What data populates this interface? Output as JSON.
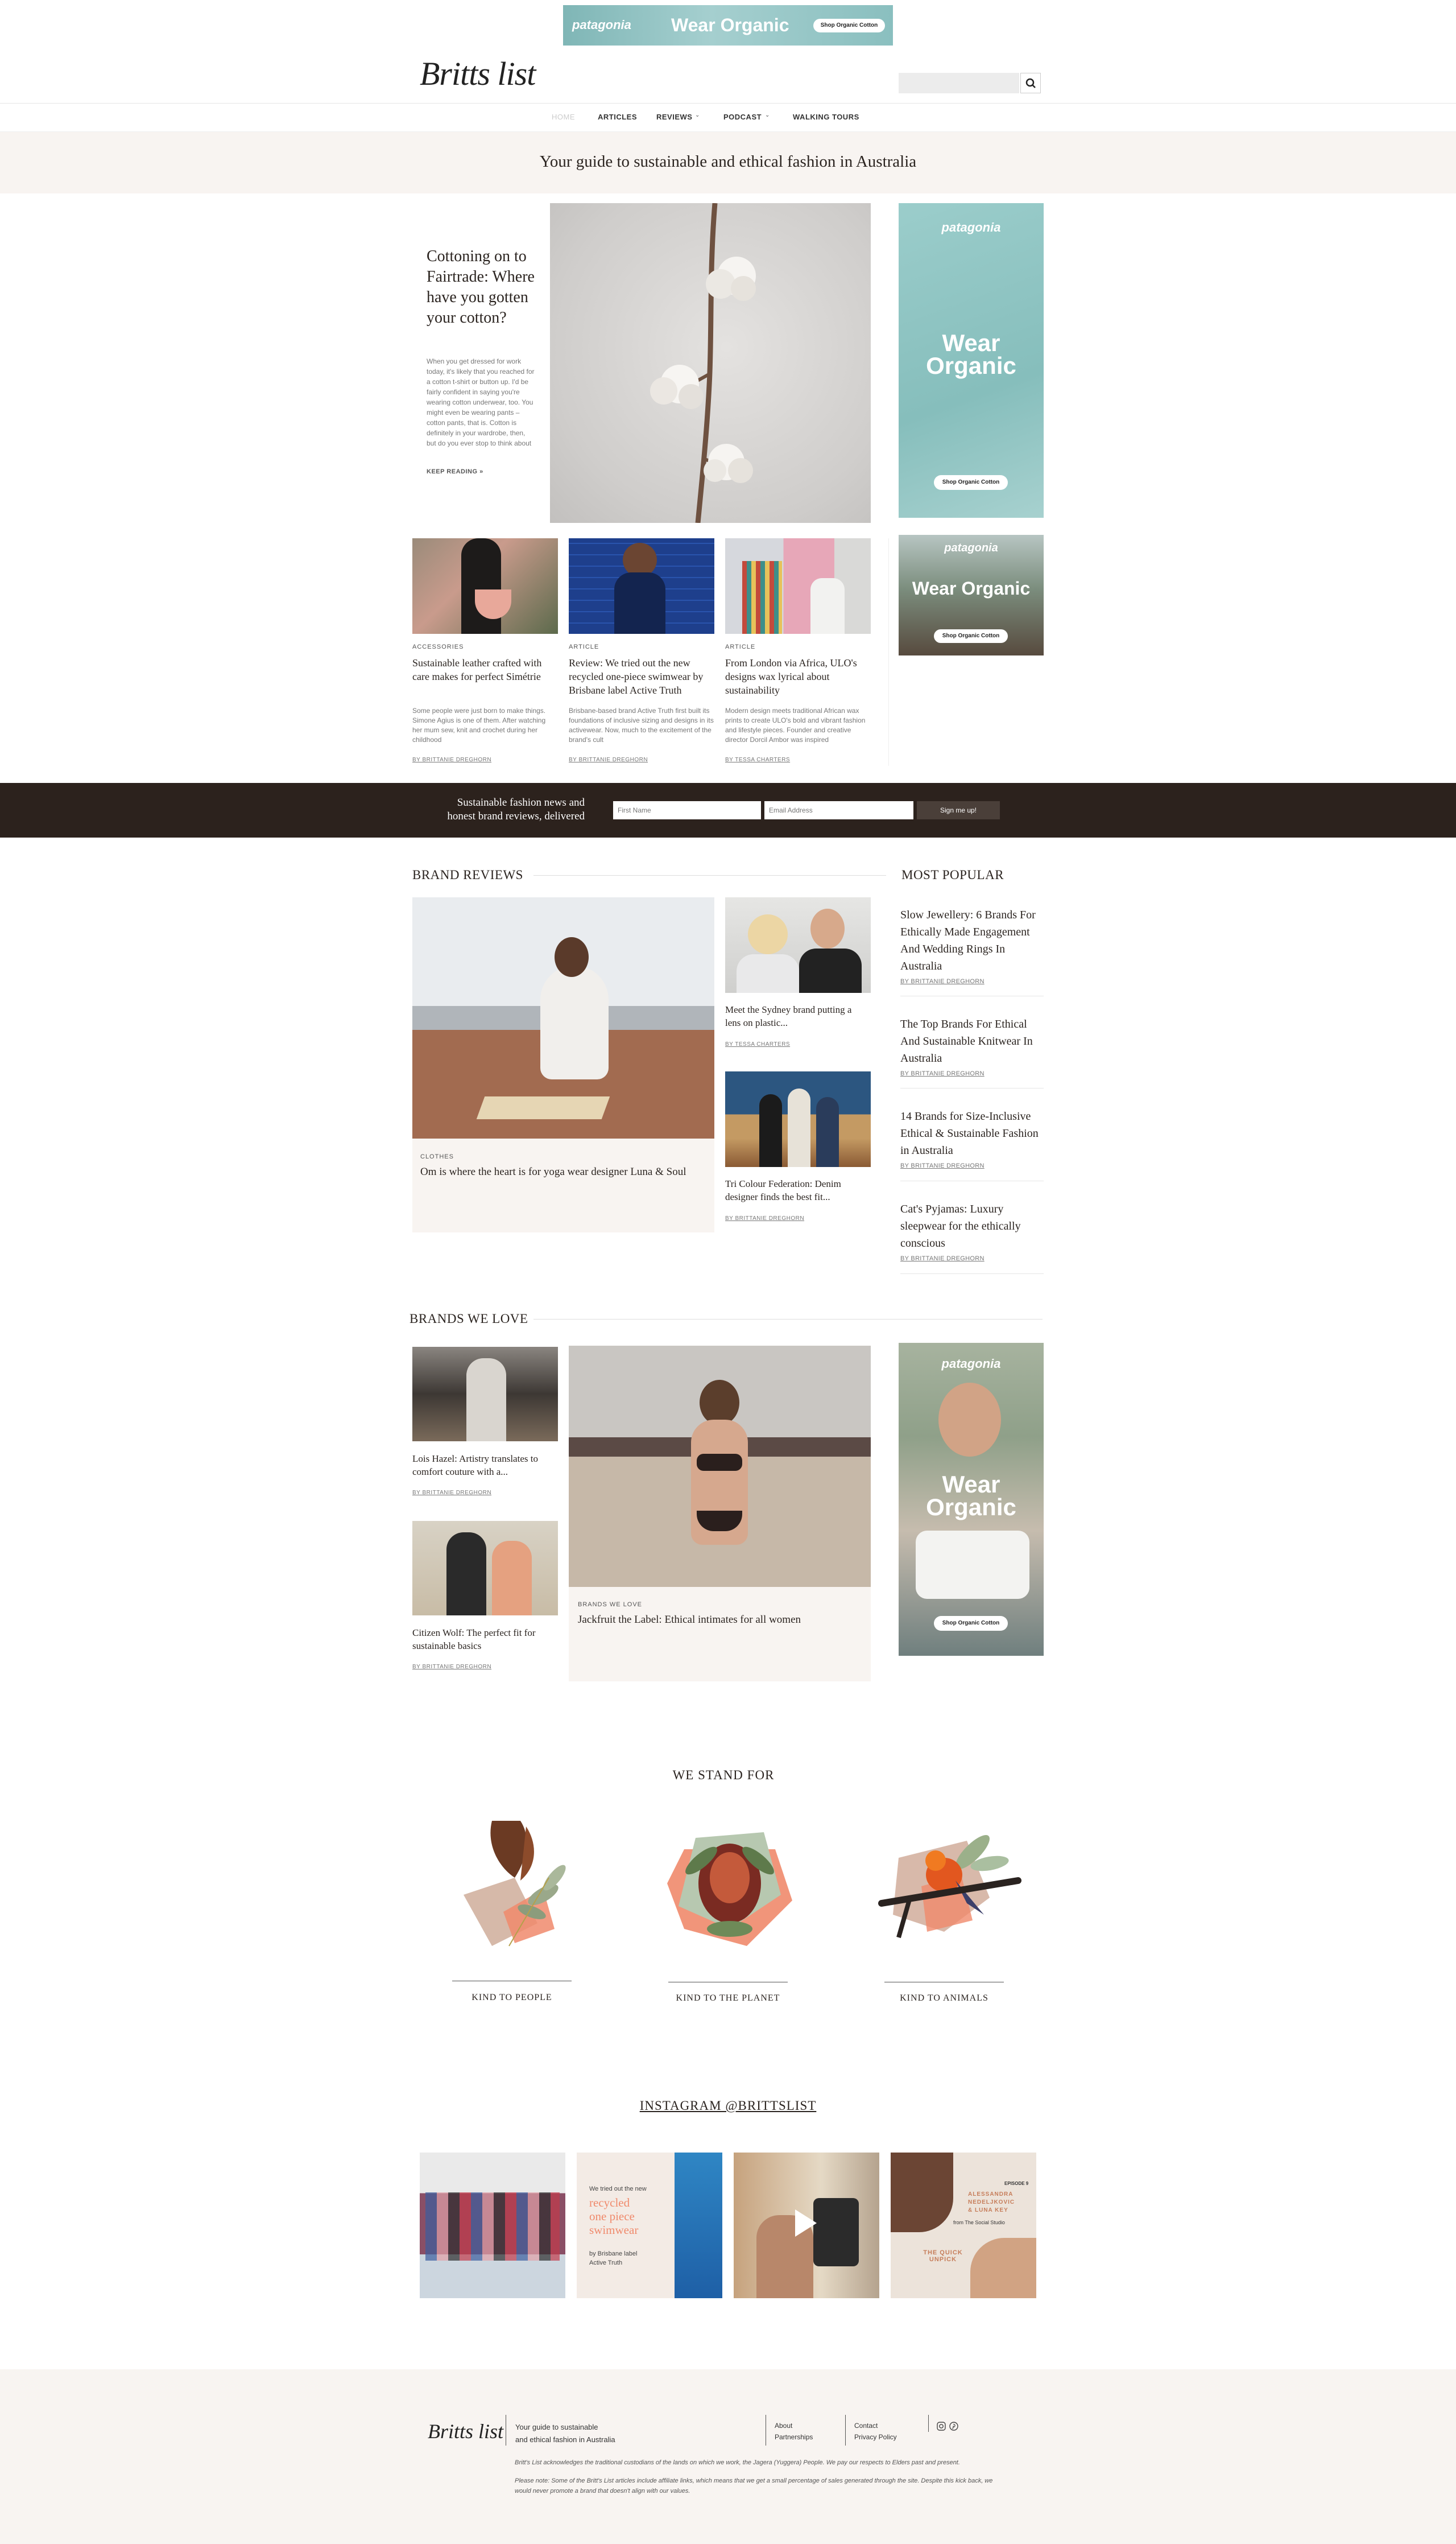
{
  "top_ad": {
    "brand": "patagonia",
    "headline": "Wear Organic",
    "cta": "Shop Organic Cotton"
  },
  "header": {
    "logo": "Britts list",
    "search_placeholder": ""
  },
  "nav": {
    "home": "HOME",
    "articles": "ARTICLES",
    "reviews": "REVIEWS",
    "podcast": "PODCAST",
    "walking_tours": "WALKING TOURS"
  },
  "tagline": "Your guide to sustainable and ethical fashion in Australia",
  "feature": {
    "title": "Cottoning on to Fairtrade: Where have you gotten your cotton?",
    "excerpt": "When you get dressed for work today, it's likely that you reached for a cotton t-shirt or button up. I'd be fairly confident in saying you're wearing cotton underwear, too. You might even be wearing pants – cotton pants, that is. Cotton is definitely in your wardrobe, then, but do you ever stop to think about",
    "read_more": "KEEP READING »"
  },
  "side_ad_1": {
    "brand": "patagonia",
    "line1": "Wear",
    "line2": "Organic",
    "cta": "Shop Organic Cotton"
  },
  "side_ad_2": {
    "brand": "patagonia",
    "headline": "Wear Organic",
    "cta": "Shop Organic Cotton"
  },
  "side_ad_3": {
    "brand": "patagonia",
    "line1": "Wear",
    "line2": "Organic",
    "cta": "Shop Organic Cotton"
  },
  "cards": [
    {
      "category": "ACCESSORIES",
      "title": "Sustainable leather crafted with care makes for perfect Simétrie",
      "excerpt": "Some people were just born to make things. Simone Agius is one of them. After watching her mum sew, knit and crochet during her childhood",
      "byline": "BY BRITTANIE DREGHORN"
    },
    {
      "category": "ARTICLE",
      "title": "Review: We tried out the new recycled one-piece swimwear by Brisbane label Active Truth",
      "excerpt": "Brisbane-based brand Active Truth first built its foundations of inclusive sizing and designs in its activewear. Now, much to the excitement of the brand's cult",
      "byline": "BY BRITTANIE DREGHORN"
    },
    {
      "category": "ARTICLE",
      "title": "From London via Africa, ULO's designs wax lyrical about sustainability",
      "excerpt": "Modern design meets traditional African wax prints to create ULO's bold and vibrant fashion and lifestyle pieces. Founder and creative director Dorcil Ambor was inspired",
      "byline": "BY TESSA CHARTERS"
    }
  ],
  "newsletter": {
    "text_line1": "Sustainable fashion news and",
    "text_line2": "honest brand reviews, delivered",
    "first_name_placeholder": "First Name",
    "email_placeholder": "Email Address",
    "button": "Sign me up!"
  },
  "brand_reviews": {
    "heading": "BRAND REVIEWS",
    "main": {
      "category": "CLOTHES",
      "title": "Om is where the heart is for yoga wear designer Luna & Soul"
    },
    "side": [
      {
        "title": "Meet the Sydney brand putting a lens on plastic...",
        "byline": "BY TESSA CHARTERS"
      },
      {
        "title": "Tri Colour Federation: Denim designer finds the best fit...",
        "byline": "BY BRITTANIE DREGHORN"
      }
    ]
  },
  "most_popular": {
    "heading": "MOST POPULAR",
    "items": [
      {
        "title": "Slow Jewellery: 6 Brands For Ethically Made Engagement And Wedding Rings In Australia",
        "byline": "BY BRITTANIE DREGHORN"
      },
      {
        "title": "The Top Brands For Ethical And Sustainable Knitwear In Australia",
        "byline": "BY BRITTANIE DREGHORN"
      },
      {
        "title": "14 Brands for Size-Inclusive Ethical & Sustainable Fashion in Australia",
        "byline": "BY BRITTANIE DREGHORN"
      },
      {
        "title": "Cat's Pyjamas: Luxury sleepwear for the ethically conscious",
        "byline": "BY BRITTANIE DREGHORN"
      }
    ]
  },
  "brands_we_love": {
    "heading": "BRANDS WE LOVE",
    "side": [
      {
        "title": "Lois Hazel: Artistry translates to comfort couture with a...",
        "byline": "BY BRITTANIE DREGHORN"
      },
      {
        "title": "Citizen Wolf: The perfect fit for sustainable basics",
        "byline": "BY BRITTANIE DREGHORN"
      }
    ],
    "main": {
      "category": "BRANDS WE LOVE",
      "title": "Jackfruit the Label: Ethical intimates for all women"
    }
  },
  "values": {
    "heading": "WE STAND FOR",
    "items": [
      "KIND TO PEOPLE",
      "KIND TO THE PLANET",
      "KIND TO ANIMALS"
    ]
  },
  "instagram": {
    "heading": "INSTAGRAM @BRITTSLIST",
    "post2": {
      "line1": "We tried out the new",
      "line2": "recycled",
      "line3": "one piece",
      "line4": "swimwear",
      "line5": "by Brisbane label",
      "line6": "Active Truth"
    },
    "post4": {
      "episode": "EPISODE 9",
      "names1": "ALESSANDRA",
      "names2": "NEDELJKOVIC",
      "names3": "& LUNA KEY",
      "from": "from The Social Studio",
      "brand": "THE QUICK UNPICK"
    }
  },
  "footer": {
    "logo": "Britts list",
    "tagline_line1": "Your guide to sustainable",
    "tagline_line2": "and ethical fashion in Australia",
    "links_col1": [
      "About",
      "Partnerships"
    ],
    "links_col2": [
      "Contact",
      "Privacy Policy"
    ],
    "acknowledgement": "Britt's List acknowledges the traditional custodians of the lands on which we work, the Jagera (Yuggera) People. We pay our respects to Elders past and present.",
    "note_line1": "Please note: Some of the Britt's List articles include affiliate links, which means that we get a small percentage of sales generated through the site. Despite this kick back, we",
    "note_line2": "would never promote a brand that doesn't align with our values."
  },
  "colors": {
    "dark": "#2c221d",
    "cream": "#f8f4f1",
    "teal": "#8fc1c2",
    "coral": "#f08a6c"
  }
}
